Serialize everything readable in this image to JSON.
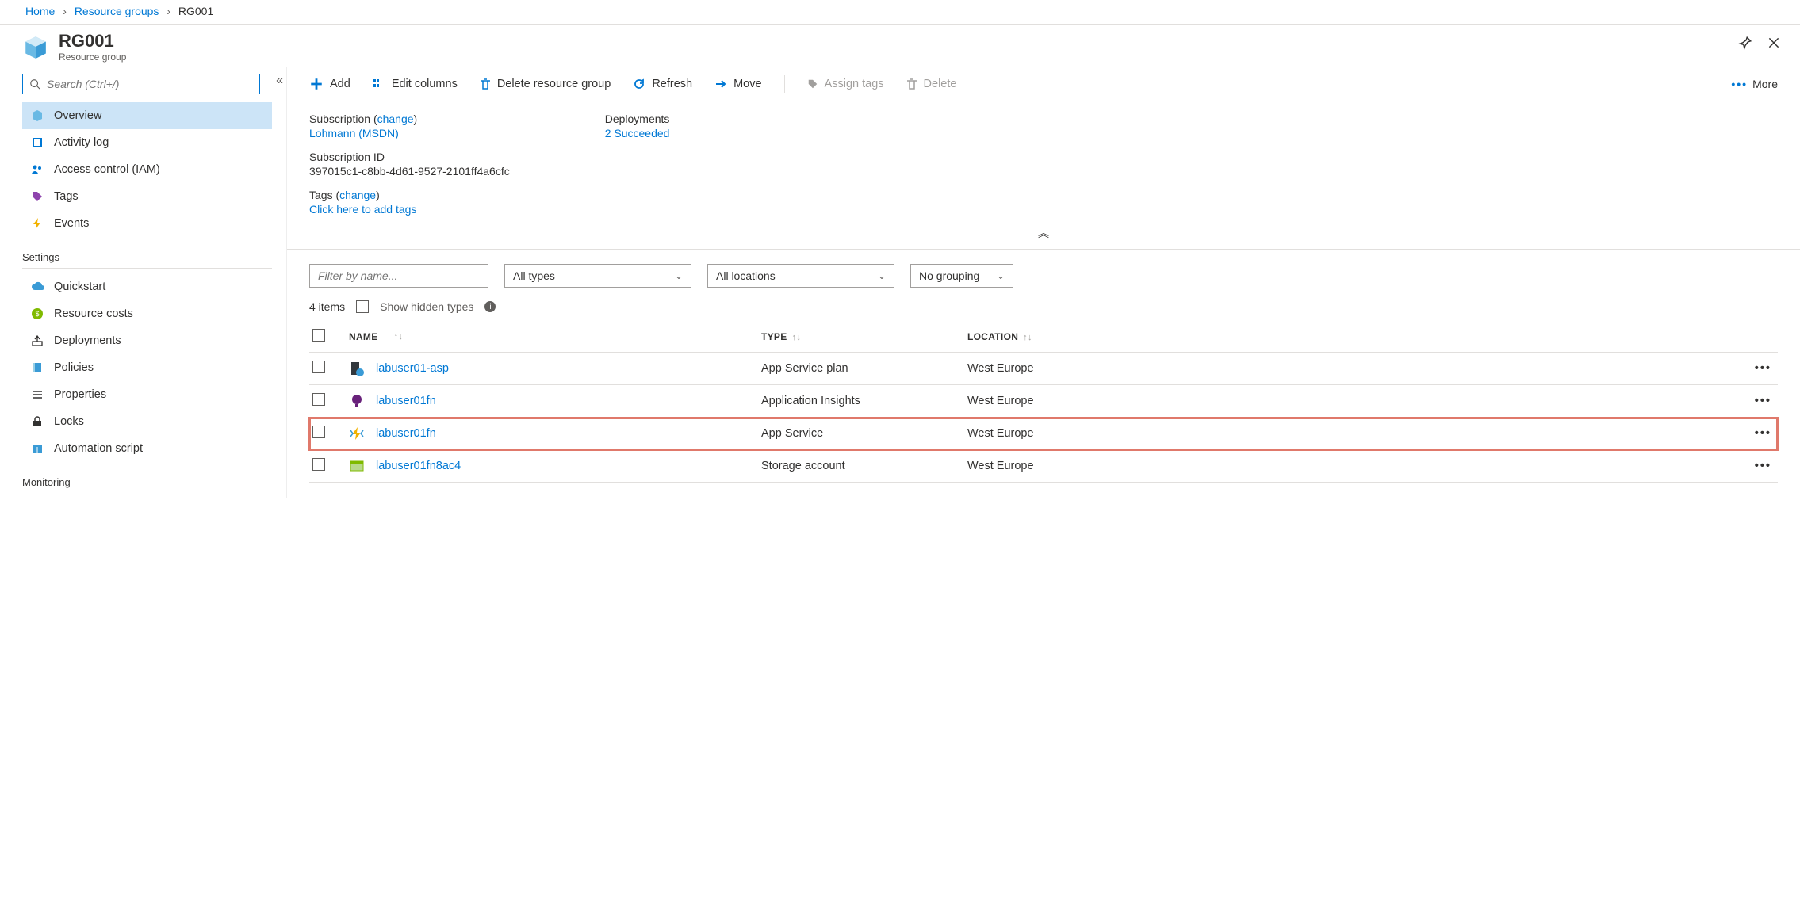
{
  "breadcrumb": {
    "home": "Home",
    "rg": "Resource groups",
    "current": "RG001"
  },
  "header": {
    "title": "RG001",
    "subtitle": "Resource group"
  },
  "sidebar": {
    "search_placeholder": "Search (Ctrl+/)",
    "items": [
      {
        "label": "Overview"
      },
      {
        "label": "Activity log"
      },
      {
        "label": "Access control (IAM)"
      },
      {
        "label": "Tags"
      },
      {
        "label": "Events"
      }
    ],
    "section_settings": "Settings",
    "settings": [
      {
        "label": "Quickstart"
      },
      {
        "label": "Resource costs"
      },
      {
        "label": "Deployments"
      },
      {
        "label": "Policies"
      },
      {
        "label": "Properties"
      },
      {
        "label": "Locks"
      },
      {
        "label": "Automation script"
      }
    ],
    "section_monitoring": "Monitoring"
  },
  "toolbar": {
    "add": "Add",
    "edit": "Edit columns",
    "delete_rg": "Delete resource group",
    "refresh": "Refresh",
    "move": "Move",
    "assign": "Assign tags",
    "delete": "Delete",
    "more": "More"
  },
  "essentials": {
    "sub_label": "Subscription ",
    "sub_change": "change",
    "sub_val": "Lohmann (MSDN)",
    "subid_label": "Subscription ID",
    "subid_val": "397015c1-c8bb-4d61-9527-2101ff4a6cfc",
    "tags_label": "Tags ",
    "tags_change": "change",
    "tags_val": "Click here to add tags",
    "dep_label": "Deployments",
    "dep_val": "2 Succeeded"
  },
  "filters": {
    "name_placeholder": "Filter by name...",
    "types": "All types",
    "locations": "All locations",
    "grouping": "No grouping"
  },
  "subbar": {
    "count": "4 items",
    "hidden": "Show hidden types"
  },
  "table": {
    "h_name": "Name",
    "h_type": "Type",
    "h_loc": "Location",
    "rows": [
      {
        "name": "labuser01-asp",
        "type": "App Service plan",
        "location": "West Europe"
      },
      {
        "name": "labuser01fn",
        "type": "Application Insights",
        "location": "West Europe"
      },
      {
        "name": "labuser01fn",
        "type": "App Service",
        "location": "West Europe"
      },
      {
        "name": "labuser01fn8ac4",
        "type": "Storage account",
        "location": "West Europe"
      }
    ]
  }
}
